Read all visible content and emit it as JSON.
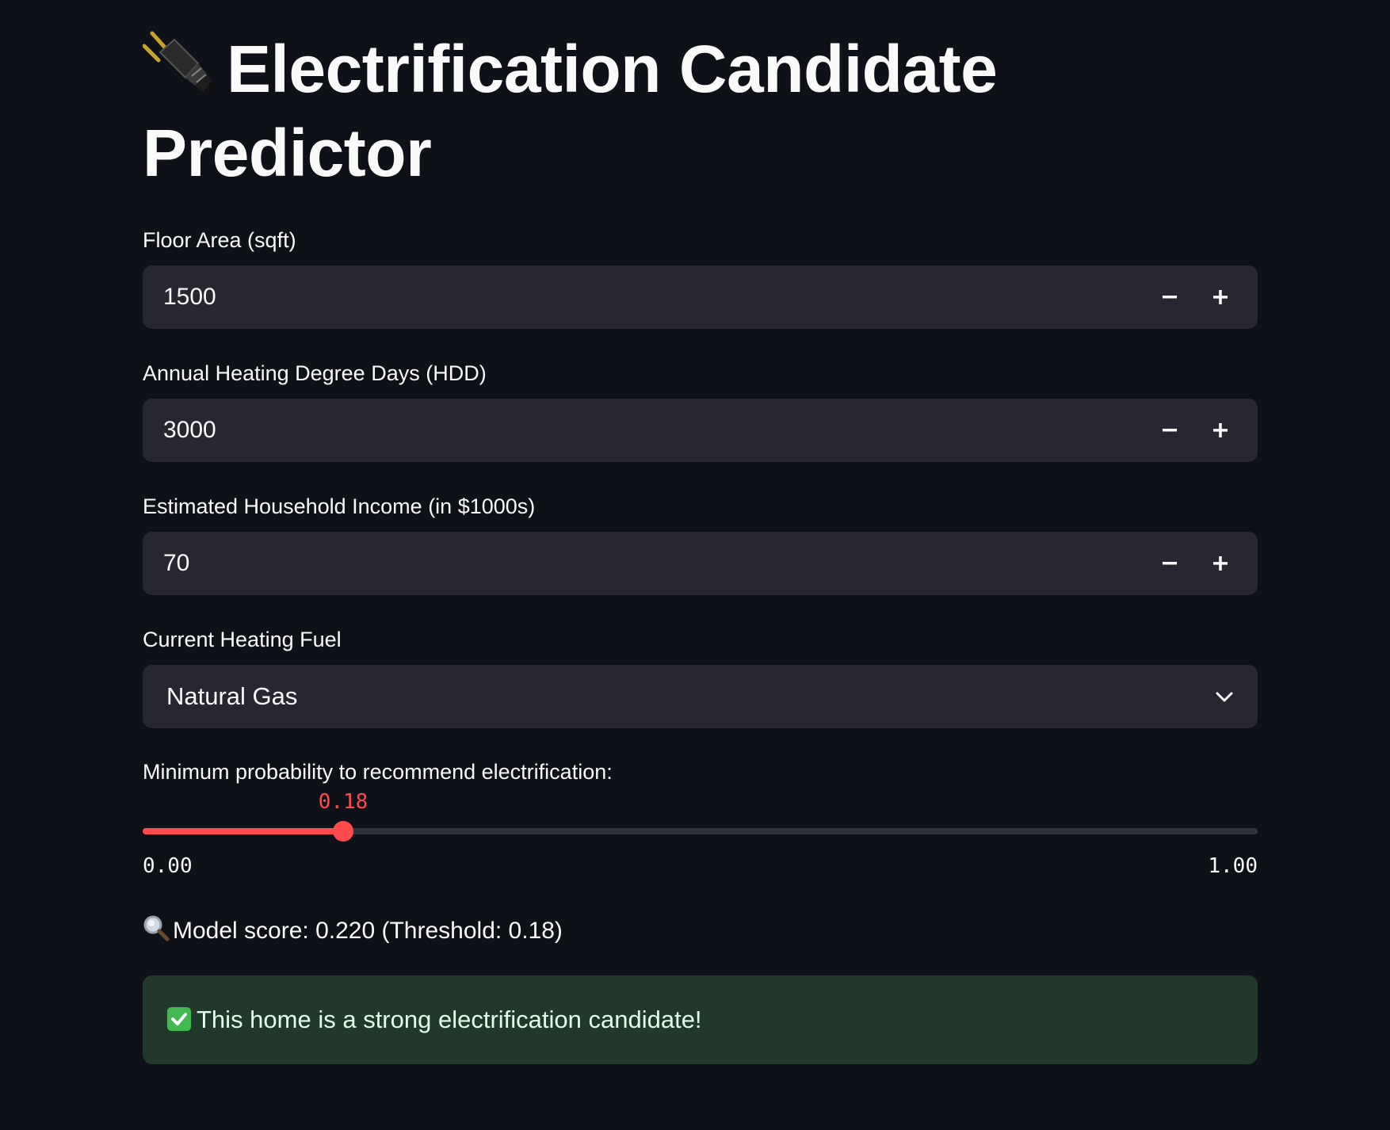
{
  "page": {
    "title": "Electrification Candidate Predictor",
    "title_icon": "electric-plug-icon"
  },
  "inputs": {
    "floor_area": {
      "label": "Floor Area (sqft)",
      "value": "1500"
    },
    "hdd": {
      "label": "Annual Heating Degree Days (HDD)",
      "value": "3000"
    },
    "income": {
      "label": "Estimated Household Income (in $1000s)",
      "value": "70"
    },
    "fuel": {
      "label": "Current Heating Fuel",
      "value": "Natural Gas"
    }
  },
  "slider": {
    "label": "Minimum probability to recommend electrification:",
    "value": 0.18,
    "value_label": "0.18",
    "min_label": "0.00",
    "max_label": "1.00",
    "min": 0,
    "max": 1
  },
  "result": {
    "score_icon": "magnifying-glass-icon",
    "score_text": "Model score: 0.220 (Threshold: 0.18)",
    "message_icon": "check-mark-icon",
    "message": "This home is a strong electrification candidate!"
  },
  "colors": {
    "background": "#0e1117",
    "input_bg": "#262730",
    "accent": "#ff4b4b",
    "success_bg": "#21392b",
    "text": "#fafafa"
  }
}
